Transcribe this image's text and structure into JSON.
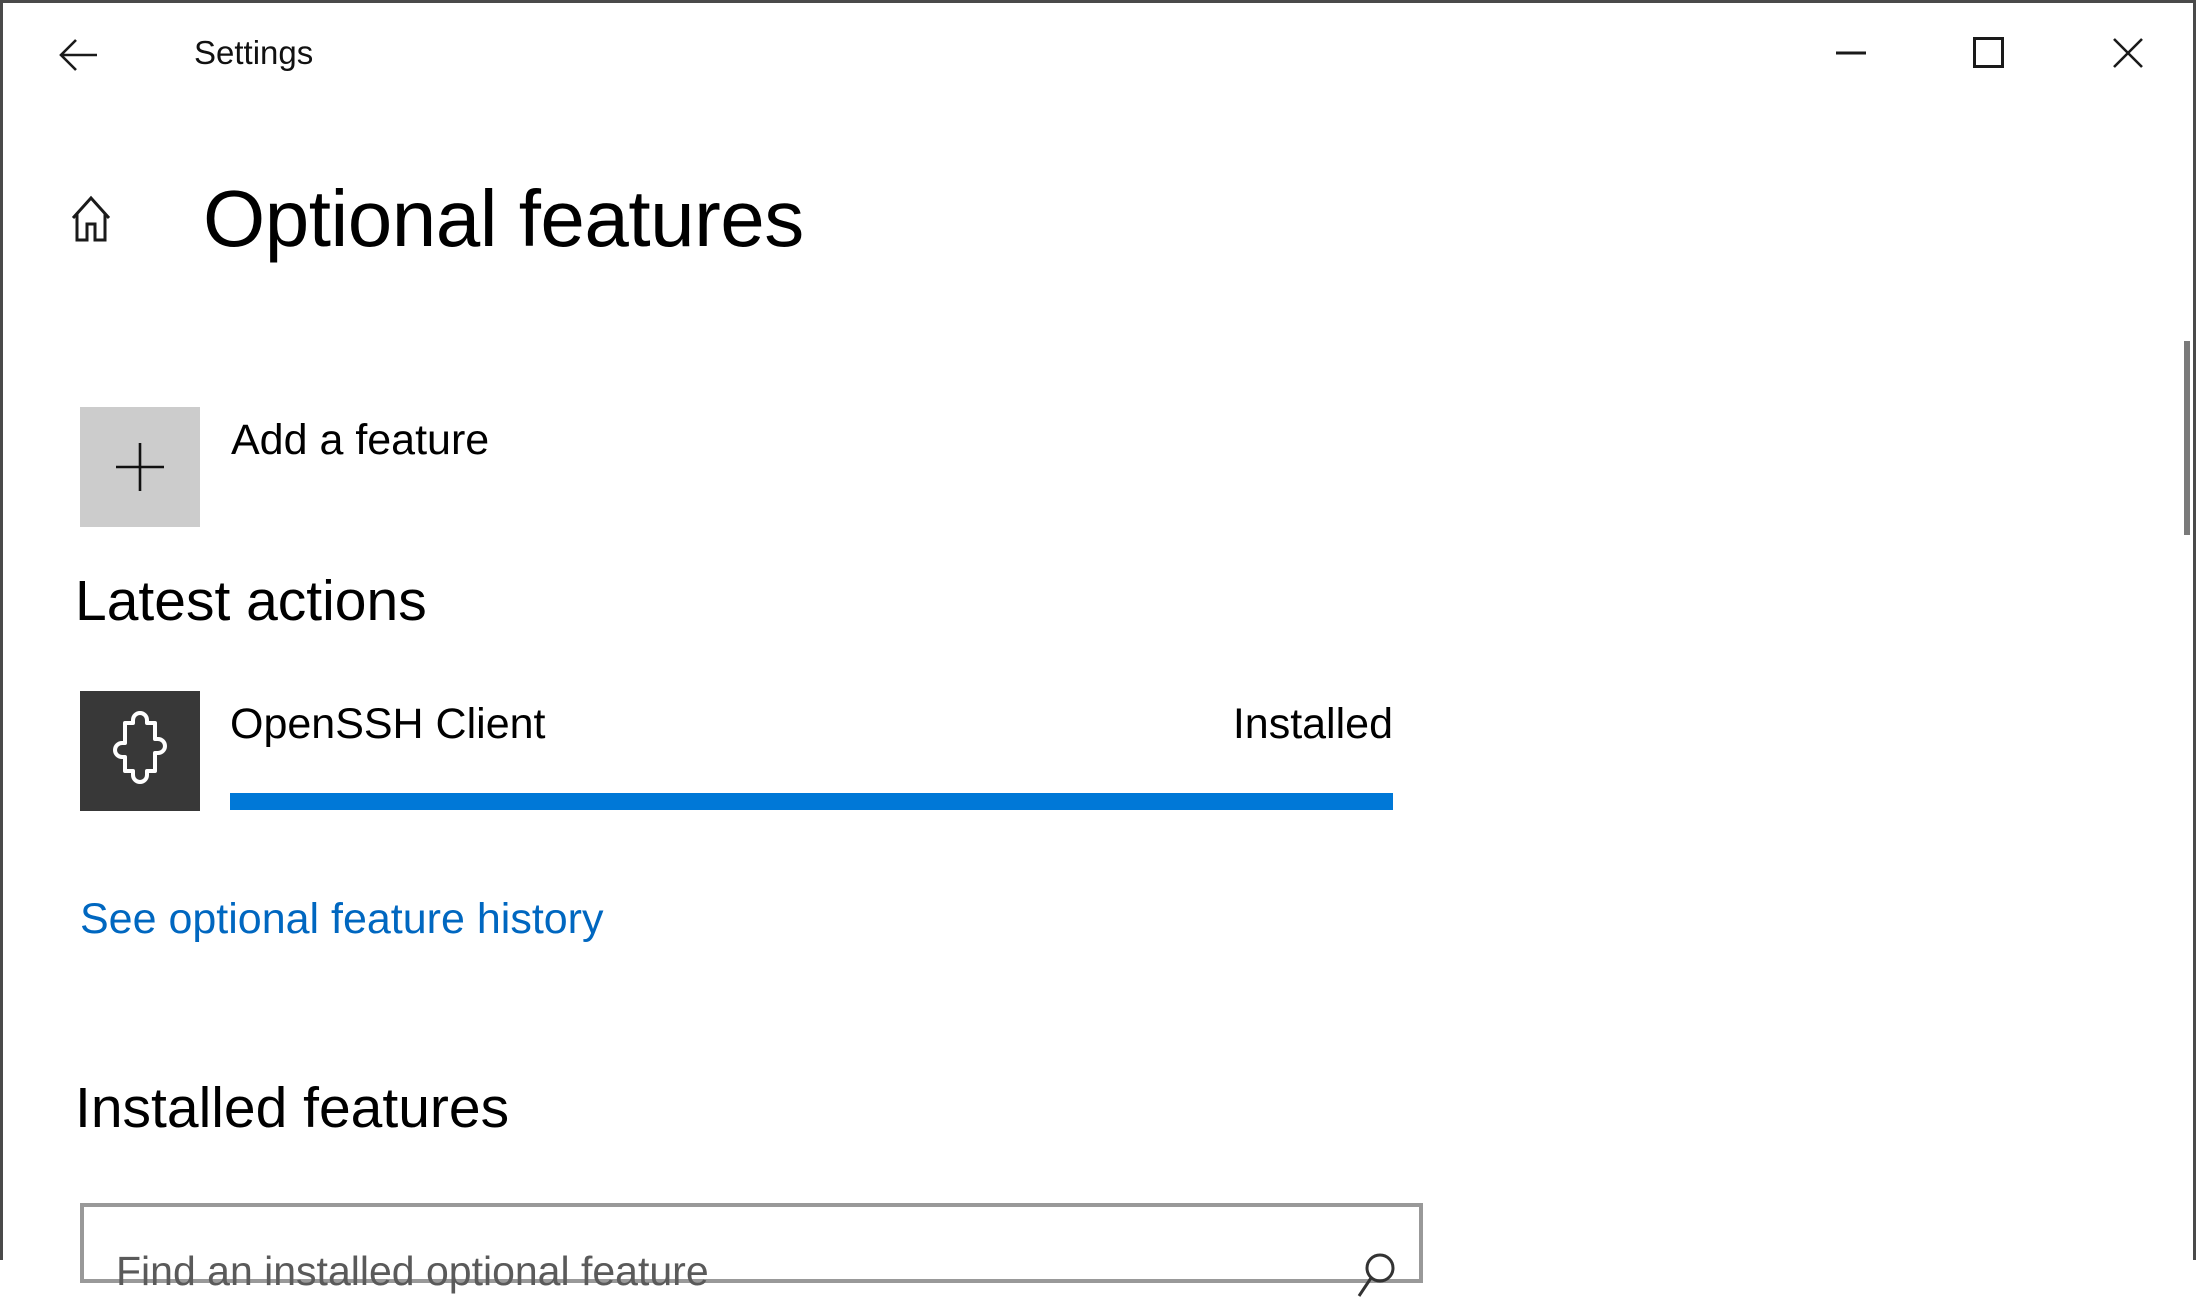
{
  "window": {
    "title": "Settings",
    "controls": {
      "minimize": "minimize-icon",
      "maximize": "maximize-icon",
      "close": "close-icon"
    },
    "back_icon": "back-arrow-icon"
  },
  "page": {
    "home_icon": "home-icon",
    "title": "Optional features"
  },
  "add_feature": {
    "icon": "plus-icon",
    "label": "Add a feature"
  },
  "latest_actions": {
    "heading": "Latest actions",
    "items": [
      {
        "icon": "puzzle-piece-icon",
        "name": "OpenSSH Client",
        "status": "Installed",
        "progress_percent": 100
      }
    ],
    "history_link": "See optional feature history"
  },
  "installed_features": {
    "heading": "Installed features",
    "search": {
      "placeholder": "Find an installed optional feature",
      "value": "",
      "icon": "search-icon"
    }
  },
  "colors": {
    "accent": "#0078d7",
    "link": "#0067c0",
    "add_tile_bg": "#cccccc",
    "feature_tile_bg": "#383838",
    "scroll_thumb": "#7a7a7a"
  }
}
